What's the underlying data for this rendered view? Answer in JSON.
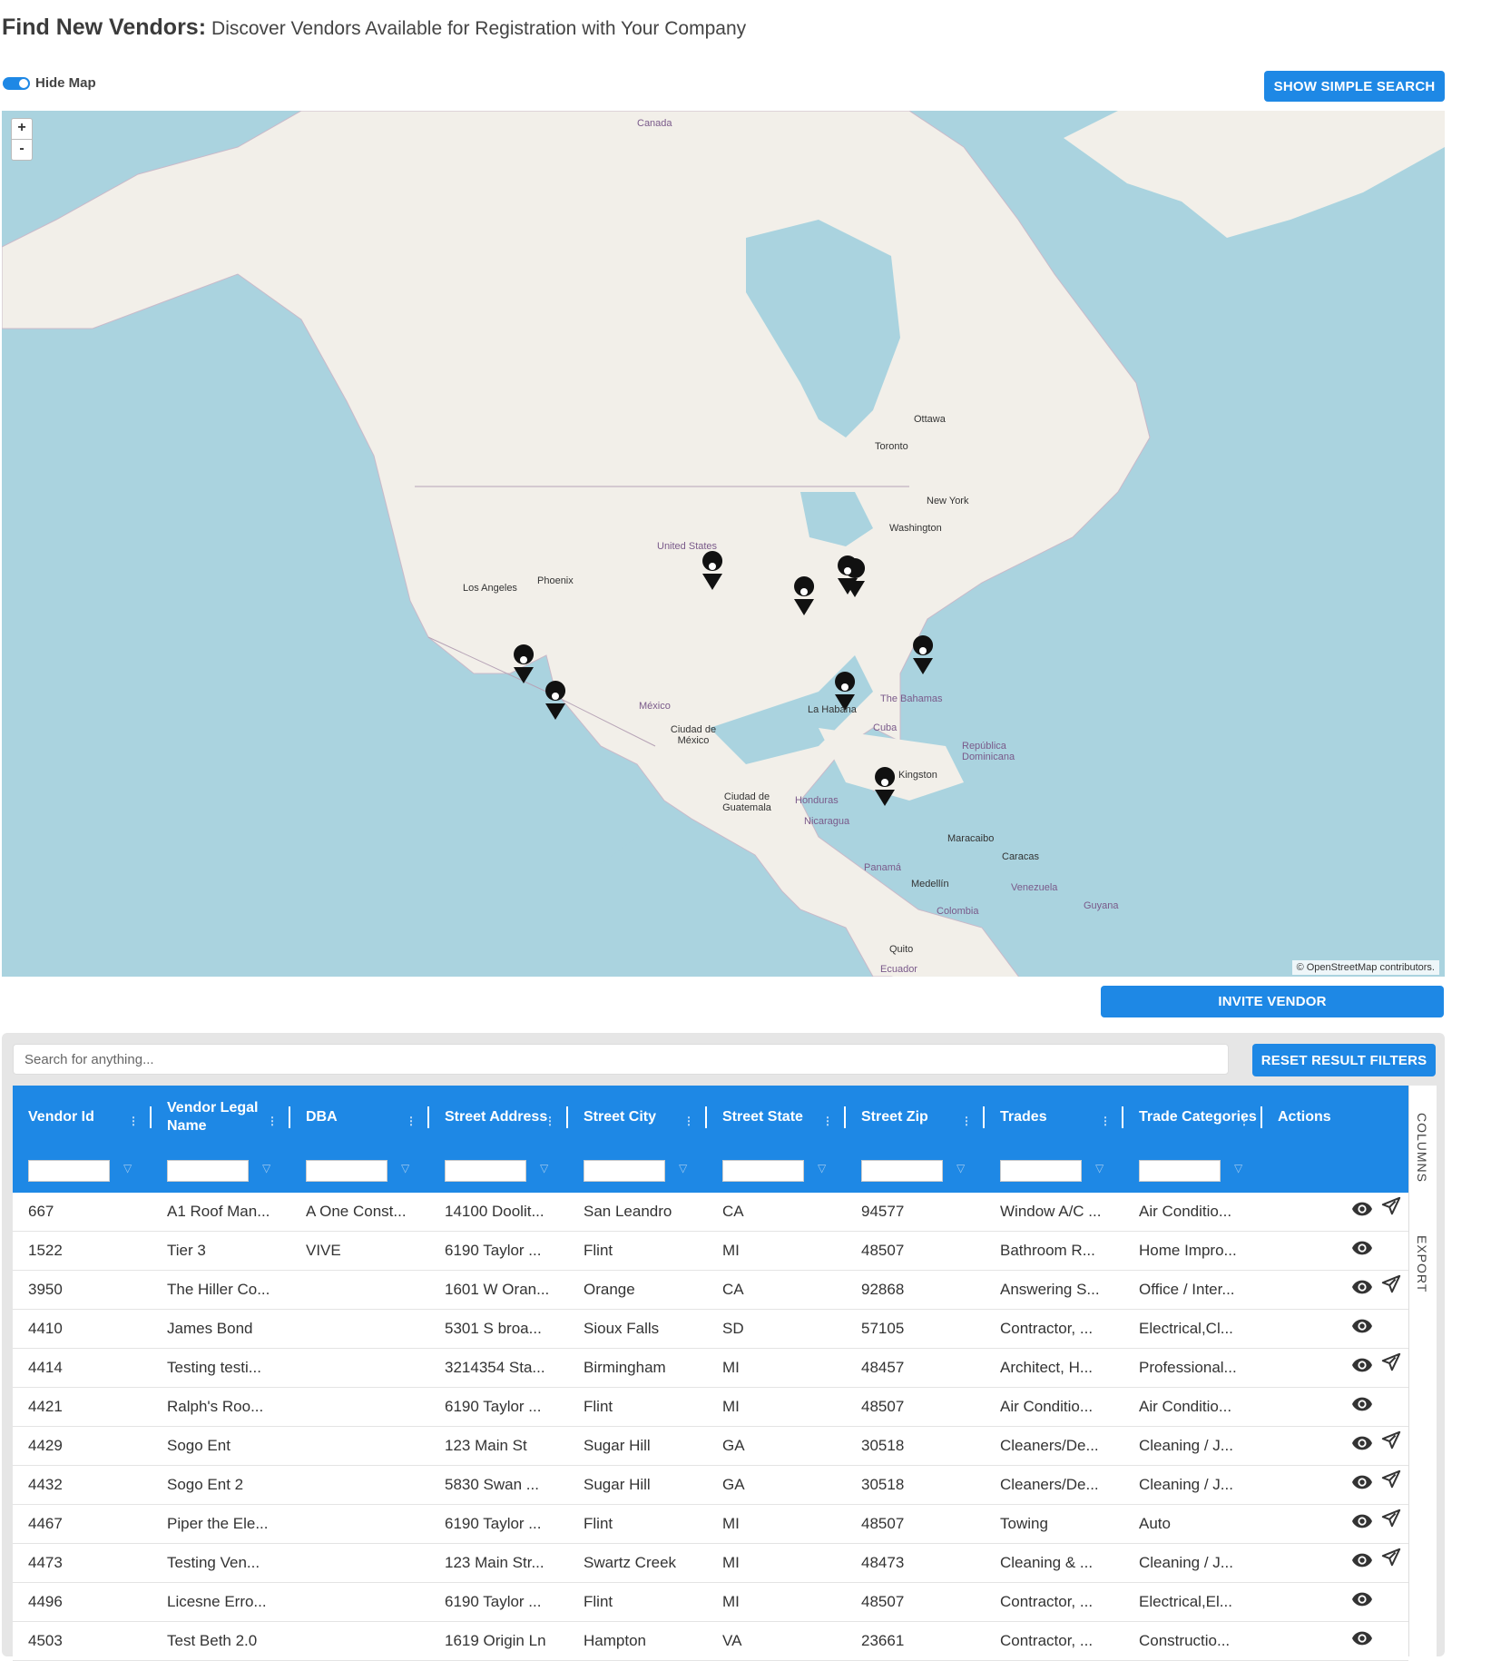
{
  "header": {
    "title": "Find New Vendors:",
    "subtitle": "Discover Vendors Available for Registration with Your Company"
  },
  "map_toggle": {
    "label": "Hide Map",
    "on": true
  },
  "buttons": {
    "simple_search": "SHOW SIMPLE SEARCH",
    "invite_vendor": "INVITE VENDOR",
    "reset_filters": "RESET RESULT FILTERS"
  },
  "map": {
    "zoom_in": "+",
    "zoom_out": "-",
    "attribution": "© OpenStreetMap contributors.",
    "labels": {
      "canada": "Canada",
      "ottawa": "Ottawa",
      "toronto": "Toronto",
      "new_york": "New York",
      "washington": "Washington",
      "united_states": "United States",
      "los_angeles": "Los Angeles",
      "phoenix": "Phoenix",
      "mexico": "México",
      "ciudad_mexico": "Ciudad de México",
      "la_habana": "La Habana",
      "cuba": "Cuba",
      "bahamas": "The Bahamas",
      "rep_dominicana": "República Dominicana",
      "kingston": "Kingston",
      "ciudad_guatemala": "Ciudad de Guatemala",
      "honduras": "Honduras",
      "nicaragua": "Nicaragua",
      "panama": "Panamá",
      "maracaibo": "Maracaibo",
      "caracas": "Caracas",
      "medellin": "Medellín",
      "venezuela": "Venezuela",
      "colombia": "Colombia",
      "guyana": "Guyana",
      "quito": "Quito",
      "ecuador": "Ecuador"
    }
  },
  "grid": {
    "search_placeholder": "Search for anything...",
    "columns": [
      "Vendor Id",
      "Vendor Legal Name",
      "DBA",
      "Street Address",
      "Street City",
      "Street State",
      "Street Zip",
      "Trades",
      "Trade Categories",
      "Actions"
    ],
    "side_tabs": {
      "columns": "COLUMNS",
      "export": "EXPORT"
    },
    "rows": [
      {
        "id": "667",
        "name": "A1 Roof Man...",
        "dba": "A One Const...",
        "address": "14100 Doolit...",
        "city": "San Leandro",
        "state": "CA",
        "zip": "94577",
        "trades": "Window A/C ...",
        "categories": "Air Conditio...",
        "invite": true
      },
      {
        "id": "1522",
        "name": "Tier 3",
        "dba": "VIVE",
        "address": "6190 Taylor ...",
        "city": "Flint",
        "state": "MI",
        "zip": "48507",
        "trades": "Bathroom R...",
        "categories": "Home Impro...",
        "invite": false
      },
      {
        "id": "3950",
        "name": "The Hiller Co...",
        "dba": "",
        "address": "1601 W Oran...",
        "city": "Orange",
        "state": "CA",
        "zip": "92868",
        "trades": "Answering S...",
        "categories": "Office / Inter...",
        "invite": true
      },
      {
        "id": "4410",
        "name": "James Bond",
        "dba": "",
        "address": "5301 S broa...",
        "city": "Sioux Falls",
        "state": "SD",
        "zip": "57105",
        "trades": "Contractor, ...",
        "categories": "Electrical,Cl...",
        "invite": false
      },
      {
        "id": "4414",
        "name": "Testing testi...",
        "dba": "",
        "address": "3214354 Sta...",
        "city": "Birmingham",
        "state": "MI",
        "zip": "48457",
        "trades": "Architect, H...",
        "categories": "Professional...",
        "invite": true
      },
      {
        "id": "4421",
        "name": "Ralph's Roo...",
        "dba": "",
        "address": "6190 Taylor ...",
        "city": "Flint",
        "state": "MI",
        "zip": "48507",
        "trades": "Air Conditio...",
        "categories": "Air Conditio...",
        "invite": false
      },
      {
        "id": "4429",
        "name": "Sogo Ent",
        "dba": "",
        "address": "123 Main St",
        "city": "Sugar Hill",
        "state": "GA",
        "zip": "30518",
        "trades": "Cleaners/De...",
        "categories": "Cleaning / J...",
        "invite": true
      },
      {
        "id": "4432",
        "name": "Sogo Ent 2",
        "dba": "",
        "address": "5830 Swan ...",
        "city": "Sugar Hill",
        "state": "GA",
        "zip": "30518",
        "trades": "Cleaners/De...",
        "categories": "Cleaning / J...",
        "invite": true
      },
      {
        "id": "4467",
        "name": "Piper the Ele...",
        "dba": "",
        "address": "6190 Taylor ...",
        "city": "Flint",
        "state": "MI",
        "zip": "48507",
        "trades": "Towing",
        "categories": "Auto",
        "invite": true
      },
      {
        "id": "4473",
        "name": "Testing Ven...",
        "dba": "",
        "address": "123 Main Str...",
        "city": "Swartz Creek",
        "state": "MI",
        "zip": "48473",
        "trades": "Cleaning & ...",
        "categories": "Cleaning / J...",
        "invite": true
      },
      {
        "id": "4496",
        "name": "Licesne Erro...",
        "dba": "",
        "address": "6190 Taylor ...",
        "city": "Flint",
        "state": "MI",
        "zip": "48507",
        "trades": "Contractor, ...",
        "categories": "Electrical,El...",
        "invite": false
      },
      {
        "id": "4503",
        "name": "Test Beth 2.0",
        "dba": "",
        "address": "1619 Origin Ln",
        "city": "Hampton",
        "state": "VA",
        "zip": "23661",
        "trades": "Contractor, ...",
        "categories": "Constructio...",
        "invite": false
      }
    ]
  },
  "icons": {
    "view": "eye-icon",
    "invite": "send-icon",
    "marker": "map-marker-icon"
  },
  "colors": {
    "accent": "#1e88e5",
    "water": "#aad3df",
    "land": "#f2efe9"
  }
}
